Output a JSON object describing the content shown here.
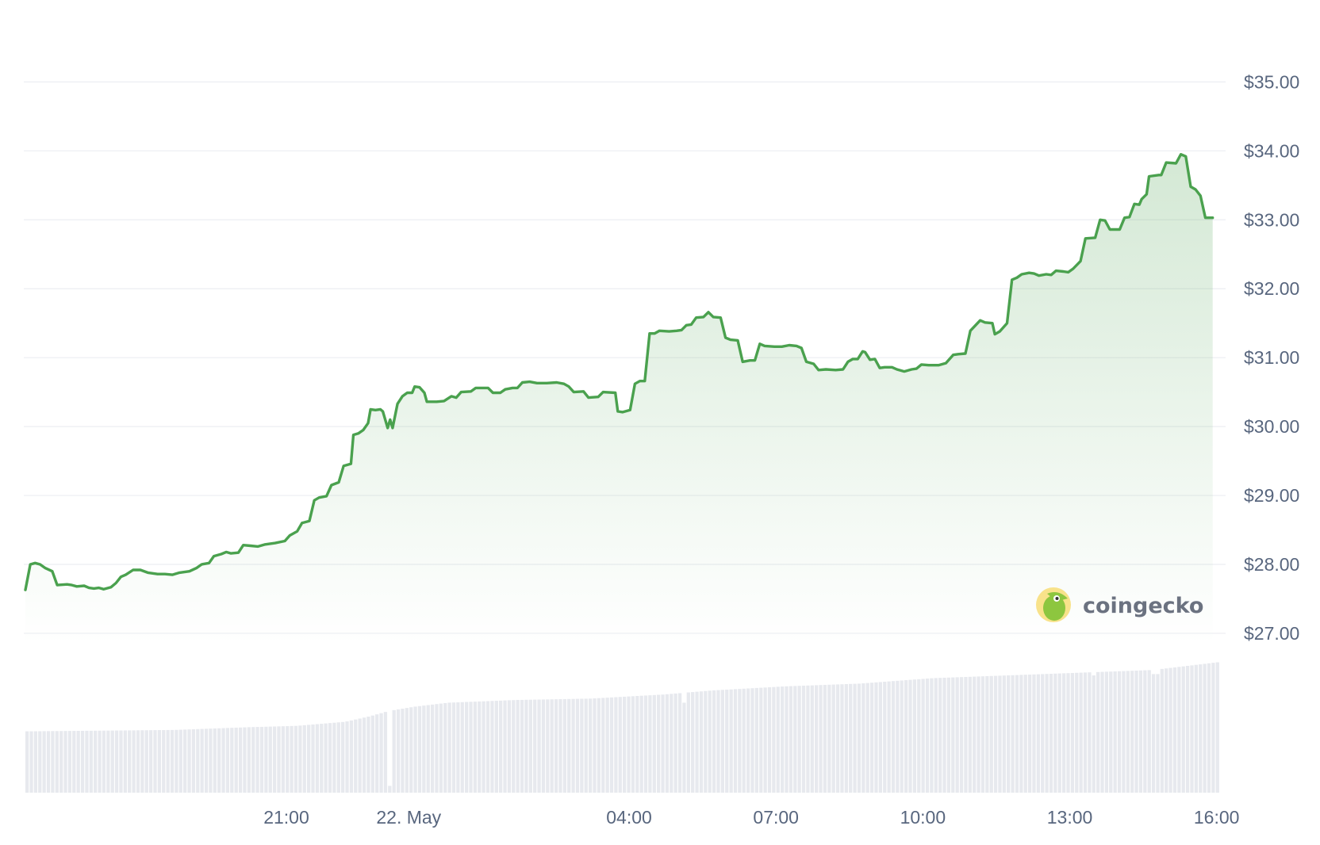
{
  "chart_data": {
    "type": "line",
    "title": "",
    "xlabel": "",
    "ylabel": "",
    "price_axis": {
      "ylim": [
        26.85,
        35.2
      ],
      "ticks": [
        27,
        28,
        29,
        30,
        31,
        32,
        33,
        34,
        35
      ],
      "tick_labels": [
        "$27.00",
        "$28.00",
        "$29.00",
        "$30.00",
        "$31.00",
        "$32.00",
        "$33.00",
        "$34.00",
        "$35.00"
      ],
      "gridlines": true,
      "position": "right"
    },
    "time_axis": {
      "unit": "hours since series start (15:40, 21 May)",
      "xlim": [
        0,
        24.4
      ],
      "ticks": [
        5.33,
        7.83,
        12.33,
        15.33,
        18.33,
        21.33,
        24.33
      ],
      "tick_labels": [
        "21:00",
        "22. May",
        "04:00",
        "07:00",
        "10:00",
        "13:00",
        "16:00"
      ]
    },
    "series": [
      {
        "name": "Price",
        "color": "#4aa14e",
        "points": [
          [
            0.0,
            27.63
          ],
          [
            0.1,
            28.0
          ],
          [
            0.2,
            28.02
          ],
          [
            0.3,
            28.0
          ],
          [
            0.4,
            27.95
          ],
          [
            0.55,
            27.9
          ],
          [
            0.65,
            27.7
          ],
          [
            0.85,
            27.71
          ],
          [
            0.95,
            27.7
          ],
          [
            1.05,
            27.68
          ],
          [
            1.2,
            27.69
          ],
          [
            1.3,
            27.66
          ],
          [
            1.4,
            27.65
          ],
          [
            1.5,
            27.66
          ],
          [
            1.6,
            27.64
          ],
          [
            1.75,
            27.67
          ],
          [
            1.85,
            27.73
          ],
          [
            1.95,
            27.82
          ],
          [
            2.05,
            27.85
          ],
          [
            2.2,
            27.92
          ],
          [
            2.35,
            27.92
          ],
          [
            2.5,
            27.88
          ],
          [
            2.7,
            27.86
          ],
          [
            2.85,
            27.86
          ],
          [
            3.0,
            27.85
          ],
          [
            3.15,
            27.88
          ],
          [
            3.35,
            27.9
          ],
          [
            3.5,
            27.95
          ],
          [
            3.6,
            28.0
          ],
          [
            3.75,
            28.02
          ],
          [
            3.85,
            28.12
          ],
          [
            4.0,
            28.15
          ],
          [
            4.1,
            28.18
          ],
          [
            4.2,
            28.16
          ],
          [
            4.35,
            28.17
          ],
          [
            4.45,
            28.28
          ],
          [
            4.6,
            28.27
          ],
          [
            4.75,
            28.26
          ],
          [
            4.9,
            28.29
          ],
          [
            5.1,
            28.31
          ],
          [
            5.3,
            28.34
          ],
          [
            5.4,
            28.42
          ],
          [
            5.55,
            28.48
          ],
          [
            5.65,
            28.6
          ],
          [
            5.8,
            28.63
          ],
          [
            5.9,
            28.93
          ],
          [
            6.0,
            28.97
          ],
          [
            6.15,
            28.99
          ],
          [
            6.25,
            29.15
          ],
          [
            6.4,
            29.19
          ],
          [
            6.5,
            29.43
          ],
          [
            6.65,
            29.46
          ],
          [
            6.7,
            29.88
          ],
          [
            6.8,
            29.9
          ],
          [
            6.9,
            29.95
          ],
          [
            7.0,
            30.05
          ],
          [
            7.05,
            30.25
          ],
          [
            7.15,
            30.24
          ],
          [
            7.25,
            30.25
          ],
          [
            7.3,
            30.22
          ],
          [
            7.4,
            29.98
          ],
          [
            7.45,
            30.1
          ],
          [
            7.5,
            29.98
          ],
          [
            7.6,
            30.33
          ],
          [
            7.7,
            30.44
          ],
          [
            7.8,
            30.49
          ],
          [
            7.9,
            30.49
          ],
          [
            7.95,
            30.58
          ],
          [
            8.05,
            30.57
          ],
          [
            8.15,
            30.49
          ],
          [
            8.2,
            30.36
          ],
          [
            8.4,
            30.36
          ],
          [
            8.55,
            30.37
          ],
          [
            8.7,
            30.44
          ],
          [
            8.8,
            30.42
          ],
          [
            8.9,
            30.5
          ],
          [
            9.1,
            30.51
          ],
          [
            9.2,
            30.56
          ],
          [
            9.45,
            30.56
          ],
          [
            9.55,
            30.49
          ],
          [
            9.7,
            30.49
          ],
          [
            9.8,
            30.54
          ],
          [
            9.95,
            30.56
          ],
          [
            10.05,
            30.56
          ],
          [
            10.15,
            30.64
          ],
          [
            10.3,
            30.65
          ],
          [
            10.45,
            30.63
          ],
          [
            10.65,
            30.63
          ],
          [
            10.85,
            30.64
          ],
          [
            11.0,
            30.62
          ],
          [
            11.1,
            30.58
          ],
          [
            11.2,
            30.5
          ],
          [
            11.4,
            30.51
          ],
          [
            11.5,
            30.42
          ],
          [
            11.7,
            30.43
          ],
          [
            11.8,
            30.5
          ],
          [
            12.05,
            30.49
          ],
          [
            12.1,
            30.22
          ],
          [
            12.2,
            30.21
          ],
          [
            12.35,
            30.24
          ],
          [
            12.45,
            30.62
          ],
          [
            12.55,
            30.66
          ],
          [
            12.65,
            30.66
          ],
          [
            12.75,
            31.35
          ],
          [
            12.85,
            31.35
          ],
          [
            12.95,
            31.39
          ],
          [
            13.15,
            31.38
          ],
          [
            13.3,
            31.39
          ],
          [
            13.4,
            31.4
          ],
          [
            13.5,
            31.47
          ],
          [
            13.6,
            31.48
          ],
          [
            13.7,
            31.58
          ],
          [
            13.85,
            31.59
          ],
          [
            13.95,
            31.66
          ],
          [
            14.05,
            31.59
          ],
          [
            14.2,
            31.58
          ],
          [
            14.3,
            31.29
          ],
          [
            14.4,
            31.26
          ],
          [
            14.55,
            31.25
          ],
          [
            14.65,
            30.94
          ],
          [
            14.8,
            30.96
          ],
          [
            14.9,
            30.96
          ],
          [
            15.0,
            31.2
          ],
          [
            15.1,
            31.17
          ],
          [
            15.3,
            31.16
          ],
          [
            15.45,
            31.16
          ],
          [
            15.6,
            31.18
          ],
          [
            15.75,
            31.17
          ],
          [
            15.85,
            31.14
          ],
          [
            15.95,
            30.94
          ],
          [
            16.1,
            30.91
          ],
          [
            16.2,
            30.82
          ],
          [
            16.35,
            30.83
          ],
          [
            16.55,
            30.82
          ],
          [
            16.7,
            30.83
          ],
          [
            16.8,
            30.94
          ],
          [
            16.9,
            30.98
          ],
          [
            17.0,
            30.98
          ],
          [
            17.1,
            31.09
          ],
          [
            17.15,
            31.08
          ],
          [
            17.25,
            30.97
          ],
          [
            17.35,
            30.98
          ],
          [
            17.45,
            30.85
          ],
          [
            17.55,
            30.86
          ],
          [
            17.7,
            30.86
          ],
          [
            17.8,
            30.83
          ],
          [
            17.95,
            30.8
          ],
          [
            18.1,
            30.83
          ],
          [
            18.2,
            30.84
          ],
          [
            18.3,
            30.9
          ],
          [
            18.45,
            30.89
          ],
          [
            18.65,
            30.89
          ],
          [
            18.8,
            30.92
          ],
          [
            18.95,
            31.04
          ],
          [
            19.05,
            31.05
          ],
          [
            19.2,
            31.06
          ],
          [
            19.3,
            31.39
          ],
          [
            19.5,
            31.54
          ],
          [
            19.6,
            31.51
          ],
          [
            19.75,
            31.5
          ],
          [
            19.8,
            31.34
          ],
          [
            19.9,
            31.38
          ],
          [
            20.05,
            31.5
          ],
          [
            20.15,
            32.13
          ],
          [
            20.25,
            32.16
          ],
          [
            20.35,
            32.21
          ],
          [
            20.5,
            32.23
          ],
          [
            20.6,
            32.22
          ],
          [
            20.7,
            32.19
          ],
          [
            20.85,
            32.21
          ],
          [
            20.95,
            32.2
          ],
          [
            21.05,
            32.26
          ],
          [
            21.2,
            32.25
          ],
          [
            21.3,
            32.24
          ],
          [
            21.4,
            32.29
          ],
          [
            21.55,
            32.4
          ],
          [
            21.65,
            32.73
          ],
          [
            21.85,
            32.74
          ],
          [
            21.95,
            33.0
          ],
          [
            22.05,
            32.99
          ],
          [
            22.15,
            32.86
          ],
          [
            22.35,
            32.86
          ],
          [
            22.45,
            33.03
          ],
          [
            22.55,
            33.04
          ],
          [
            22.65,
            33.23
          ],
          [
            22.75,
            33.22
          ],
          [
            22.8,
            33.3
          ],
          [
            22.9,
            33.37
          ],
          [
            22.95,
            33.63
          ],
          [
            23.15,
            33.65
          ],
          [
            23.2,
            33.65
          ],
          [
            23.3,
            33.83
          ],
          [
            23.5,
            33.82
          ],
          [
            23.6,
            33.95
          ],
          [
            23.7,
            33.92
          ],
          [
            23.8,
            33.48
          ],
          [
            23.9,
            33.44
          ],
          [
            24.0,
            33.35
          ],
          [
            24.1,
            33.03
          ],
          [
            24.25,
            33.03
          ]
        ]
      },
      {
        "name": "Volume",
        "color": "#e7e9ee",
        "bar_count": 280,
        "relative_scale": [
          0,
          1
        ],
        "anchors": [
          [
            0.0,
            0.45
          ],
          [
            3.0,
            0.46
          ],
          [
            4.5,
            0.48
          ],
          [
            5.5,
            0.49
          ],
          [
            6.5,
            0.52
          ],
          [
            7.0,
            0.56
          ],
          [
            7.4,
            0.6
          ],
          [
            7.9,
            0.63
          ],
          [
            8.6,
            0.66
          ],
          [
            10.0,
            0.68
          ],
          [
            11.5,
            0.69
          ],
          [
            13.0,
            0.72
          ],
          [
            14.0,
            0.75
          ],
          [
            15.5,
            0.78
          ],
          [
            17.0,
            0.8
          ],
          [
            18.5,
            0.84
          ],
          [
            20.0,
            0.86
          ],
          [
            21.5,
            0.88
          ],
          [
            23.0,
            0.9
          ],
          [
            24.4,
            0.96
          ]
        ],
        "dips": [
          [
            7.43,
            0.05
          ],
          [
            13.45,
            0.66
          ],
          [
            21.8,
            0.86
          ],
          [
            23.05,
            0.87
          ]
        ]
      }
    ],
    "fill": {
      "top_color": "#4aa14e",
      "top_opacity": 0.24,
      "bottom_opacity": 0.0
    },
    "watermark": {
      "text": "coingecko",
      "position": "bottom-right of price panel"
    }
  }
}
